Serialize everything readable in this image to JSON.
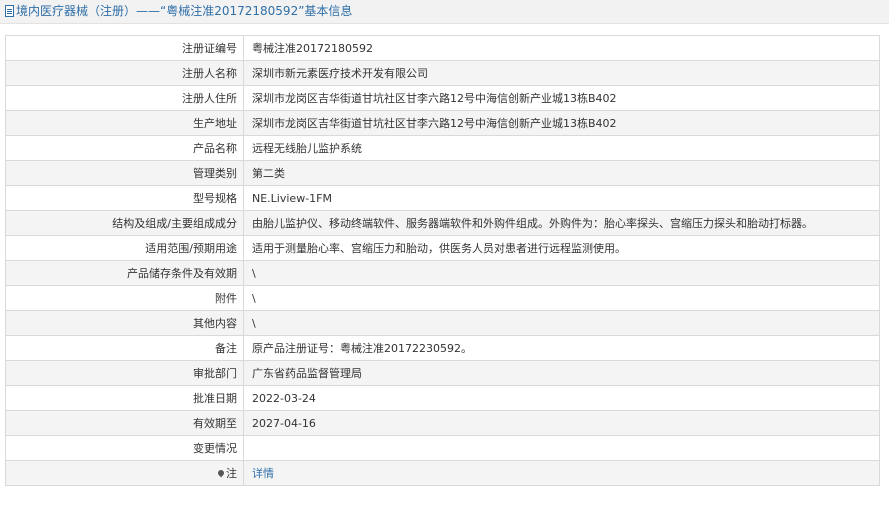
{
  "header": {
    "title": "境内医疗器械（注册）——“粤械注准20172180592”基本信息",
    "icon": "document-icon"
  },
  "rows": [
    {
      "label": "注册证编号",
      "value": "粤械注准20172180592"
    },
    {
      "label": "注册人名称",
      "value": "深圳市新元素医疗技术开发有限公司"
    },
    {
      "label": "注册人住所",
      "value": "深圳市龙岗区吉华街道甘坑社区甘李六路12号中海信创新产业城13栋B402"
    },
    {
      "label": "生产地址",
      "value": "深圳市龙岗区吉华街道甘坑社区甘李六路12号中海信创新产业城13栋B402"
    },
    {
      "label": "产品名称",
      "value": "远程无线胎儿监护系统"
    },
    {
      "label": "管理类别",
      "value": "第二类"
    },
    {
      "label": "型号规格",
      "value": "NE.Liview-1FM"
    },
    {
      "label": "结构及组成/主要组成成分",
      "value": "由胎儿监护仪、移动终端软件、服务器端软件和外购件组成。外购件为：胎心率探头、宫缩压力探头和胎动打标器。"
    },
    {
      "label": "适用范围/预期用途",
      "value": "适用于测量胎心率、宫缩压力和胎动，供医务人员对患者进行远程监测使用。"
    },
    {
      "label": "产品储存条件及有效期",
      "value": "\\"
    },
    {
      "label": "附件",
      "value": "\\"
    },
    {
      "label": "其他内容",
      "value": "\\"
    },
    {
      "label": "备注",
      "value": "原产品注册证号：粤械注准20172230592。"
    },
    {
      "label": "审批部门",
      "value": "广东省药品监督管理局"
    },
    {
      "label": "批准日期",
      "value": "2022-03-24"
    },
    {
      "label": "有效期至",
      "value": "2027-04-16"
    },
    {
      "label": "变更情况",
      "value": ""
    }
  ],
  "note": {
    "label": "注",
    "icon": "pin-icon",
    "link_text": "详情"
  },
  "colors": {
    "accent": "#2f6fa8",
    "alt_row": "#f4f4f4",
    "border": "#d9d9d9"
  }
}
